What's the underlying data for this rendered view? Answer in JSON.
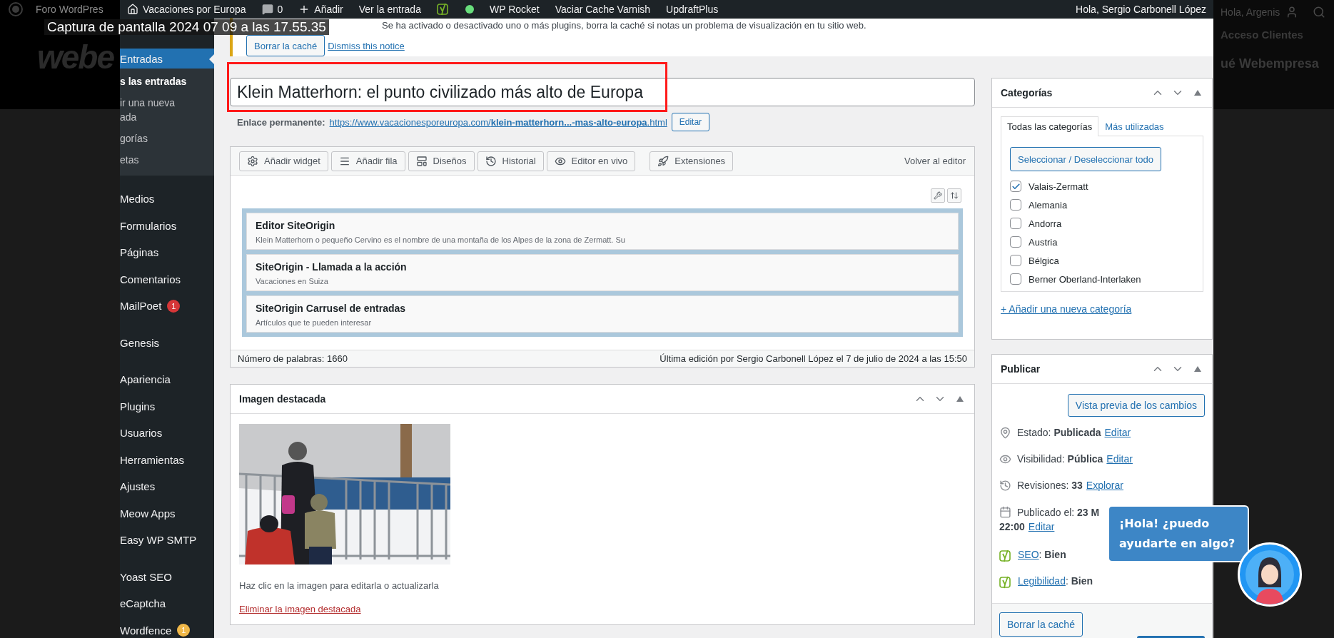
{
  "caption": "Captura de pantalla 2024 07 09 a las 17.55.35",
  "backdrop": {
    "left_site": "Foro WordPres",
    "left_logo": "webe",
    "right_greeting": "Hola, Argenis",
    "right_links": [
      "Acceso Clientes",
      "ué Webempresa"
    ]
  },
  "admin_bar": {
    "site": "Vacaciones por Europa",
    "comments": "0",
    "new": "Añadir",
    "view": "Ver la entrada",
    "items": [
      "WP Rocket",
      "Vaciar Cache Varnish",
      "UpdraftPlus"
    ],
    "greeting": "Hola, Sergio Carbonell López"
  },
  "sidebar": {
    "groups": [
      [
        {
          "label": "Entradas",
          "selected": true,
          "children": [
            {
              "label": "s las entradas",
              "selected": true
            },
            {
              "label": "ir una nueva ada",
              "selected": false
            },
            {
              "label": "gorías",
              "selected": false
            },
            {
              "label": "etas",
              "selected": false
            }
          ]
        }
      ],
      [
        {
          "label": "Medios",
          "selected": false
        },
        {
          "label": "Formularios",
          "selected": false
        },
        {
          "label": "Páginas",
          "selected": false
        },
        {
          "label": "Comentarios",
          "selected": false
        },
        {
          "label": "MailPoet",
          "selected": false,
          "badge": {
            "text": "1",
            "color": "#d63638"
          }
        }
      ],
      [
        {
          "label": "Genesis",
          "selected": false
        }
      ],
      [
        {
          "label": "Apariencia",
          "selected": false
        },
        {
          "label": "Plugins",
          "selected": false
        },
        {
          "label": "Usuarios",
          "selected": false
        },
        {
          "label": "Herramientas",
          "selected": false
        },
        {
          "label": "Ajustes",
          "selected": false
        },
        {
          "label": "Meow Apps",
          "selected": false
        },
        {
          "label": "Easy WP SMTP",
          "selected": false
        }
      ],
      [
        {
          "label": "Yoast SEO",
          "selected": false
        },
        {
          "label": "eCaptcha",
          "selected": false
        },
        {
          "label": "Wordfence",
          "selected": false,
          "badge": {
            "text": "1",
            "color": "#f0b849"
          }
        }
      ]
    ]
  },
  "notice": {
    "text": "Se ha activado o desactivado uno o más plugins, borra la caché si notas un problema de visualización en tu sitio web.",
    "button": "Borrar la caché",
    "link": "Dismiss this notice"
  },
  "post": {
    "title": "Klein Matterhorn: el punto civilizado más alto de Europa",
    "title_highlighted": true,
    "permalink_label": "Enlace permanente:",
    "permalink": "https://www.vacacionesporeuropa.com/**klein-matterhorn...-mas-alto-europa**.html",
    "permalink_button": "Editar"
  },
  "builder": {
    "toolbar": [
      {
        "label": "Añadir widget",
        "kind": "gear"
      },
      {
        "label": "Añadir fila",
        "kind": "rows"
      },
      {
        "label": "Diseños",
        "kind": "layout"
      },
      {
        "label": "Historial",
        "kind": "history"
      },
      {
        "label": "Editor en vivo",
        "kind": "eye"
      },
      {
        "label": "Extensiones",
        "kind": "rocket"
      }
    ],
    "back": "Volver al editor",
    "widgets": [
      {
        "title": "Editor SiteOrigin",
        "summary": "Klein Matterhorn o pequeño Cervino es el nombre de una montaña de los Alpes de la zona de Zermatt. Su"
      },
      {
        "title": "SiteOrigin - Llamada a la acción",
        "summary": "Vacaciones en Suiza"
      },
      {
        "title": "SiteOrigin Carrusel de entradas",
        "summary": "Artículos que te pueden interesar"
      }
    ],
    "word_count": "Número de palabras: 1660",
    "last_edit": "Última edición por Sergio Carbonell López el 7 de julio de 2024 a las 15:50"
  },
  "featured_image": {
    "title": "Imagen destacada",
    "hint": "Haz clic en la imagen para editarla o actualizarla",
    "remove": "Eliminar la imagen destacada"
  },
  "categories": {
    "title": "Categorías",
    "tabs": [
      {
        "label": "Todas las categorías",
        "selected": true
      },
      {
        "label": "Más utilizadas",
        "selected": false
      }
    ],
    "toggle_all": "Seleccionar / Deseleccionar todo",
    "items": [
      {
        "label": "Valais-Zermatt",
        "checked": true
      },
      {
        "label": "Alemania",
        "checked": false
      },
      {
        "label": "Andorra",
        "checked": false
      },
      {
        "label": "Austria",
        "checked": false
      },
      {
        "label": "Bélgica",
        "checked": false
      },
      {
        "label": "Berner Oberland-Interlaken",
        "checked": false
      }
    ],
    "add": "+ Añadir una nueva categoría"
  },
  "publish": {
    "title": "Publicar",
    "preview": "Vista previa de los cambios",
    "rows": [
      {
        "kind": "status",
        "text": "Estado: **Publicada**",
        "link": "Editar"
      },
      {
        "kind": "visibility",
        "text": "Visibilidad: **Pública**",
        "link": "Editar"
      },
      {
        "kind": "revisions",
        "text": "Revisiones: **33**",
        "link": "Explorar"
      },
      {
        "kind": "date",
        "text": "Publicado el: **23 M**",
        "second_line": "22:00",
        "link": "Editar"
      },
      {
        "kind": "seo",
        "link": "SEO",
        "text": ": **Bien**"
      },
      {
        "kind": "seo",
        "link": "Legibilidad",
        "text": ": **Bien**"
      }
    ],
    "clear_cache": "Borrar la caché"
  },
  "chat": {
    "message": "¡Hola! ¿puedo ayudarte en algo?"
  }
}
